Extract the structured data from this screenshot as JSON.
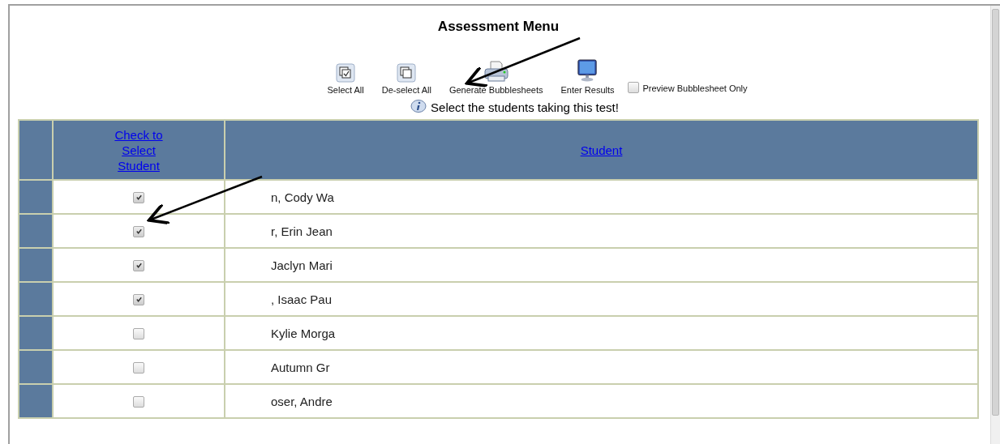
{
  "title": "Assessment Menu",
  "toolbar": [
    {
      "kind": "select",
      "label": "Select All"
    },
    {
      "kind": "deselect",
      "label": "De-select All"
    },
    {
      "kind": "print",
      "label": "Generate Bubblesheets"
    },
    {
      "kind": "monitor",
      "label": "Enter Results"
    },
    {
      "kind": "checkbox",
      "label": "Preview Bubblesheet Only",
      "checked": false
    }
  ],
  "info": "Select the students taking this test!",
  "table": {
    "columns": [
      "Check to Select Student",
      "Student"
    ],
    "rows": [
      {
        "checked": true,
        "student": "n, Cody Wa"
      },
      {
        "checked": true,
        "student": "r, Erin Jean"
      },
      {
        "checked": true,
        "student": "Jaclyn Mari"
      },
      {
        "checked": true,
        "student": ", Isaac Pau"
      },
      {
        "checked": false,
        "student": "Kylie Morga"
      },
      {
        "checked": false,
        "student": "Autumn Gr"
      },
      {
        "checked": false,
        "student": "oser, Andre"
      }
    ]
  }
}
